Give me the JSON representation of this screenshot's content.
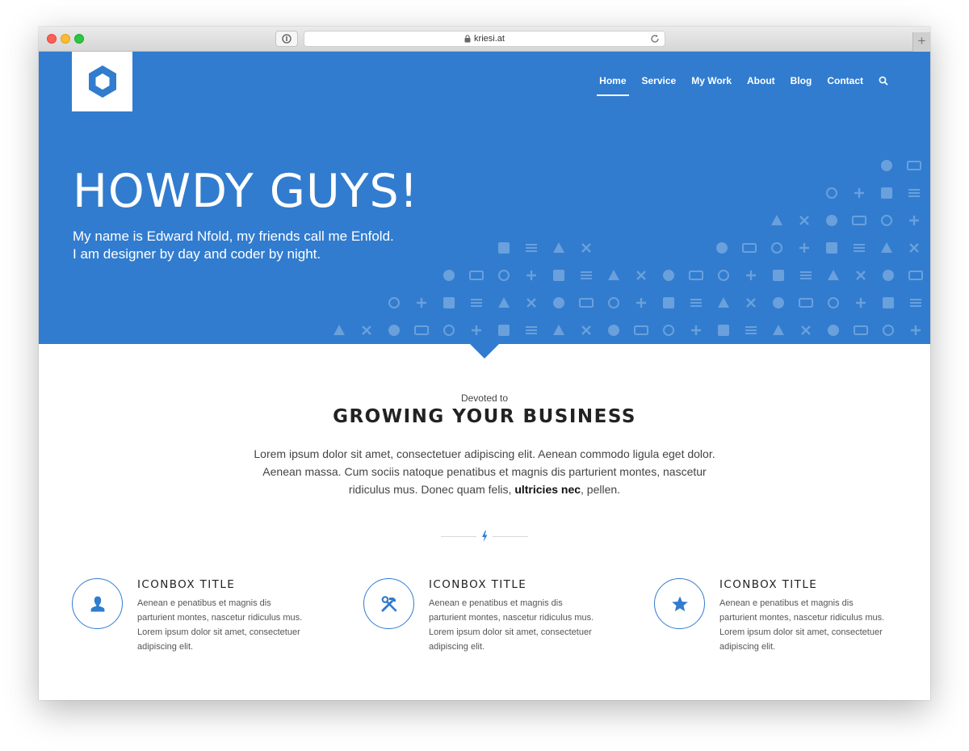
{
  "browser": {
    "url": "kriesi.at",
    "new_tab_label": "+"
  },
  "nav": {
    "items": [
      {
        "label": "Home",
        "active": true
      },
      {
        "label": "Service",
        "active": false
      },
      {
        "label": "My Work",
        "active": false
      },
      {
        "label": "About",
        "active": false
      },
      {
        "label": "Blog",
        "active": false
      },
      {
        "label": "Contact",
        "active": false
      }
    ],
    "search_icon": "search-icon"
  },
  "hero": {
    "title": "HOWDY GUYS!",
    "subtitle_line1": "My name is Edward Nfold, my friends call me Enfold.",
    "subtitle_line2": "I am designer by day and coder by night."
  },
  "section": {
    "kicker": "Devoted to",
    "heading": "GROWING YOUR BUSINESS",
    "intro_main": "Lorem ipsum dolor sit amet, consectetuer adipiscing elit. Aenean commodo ligula eget dolor. Aenean massa. Cum sociis natoque penatibus et magnis dis parturient montes, nascetur ridiculus mus. Donec quam felis, ",
    "intro_bold": "ultricies nec",
    "intro_tail": ", pellen."
  },
  "iconboxes": [
    {
      "icon": "user-icon",
      "title": "ICONBOX TITLE",
      "text": "Aenean e penatibus et magnis dis parturient montes, nascetur ridiculus mus. Lorem ipsum dolor sit amet, consectetuer adipiscing elit."
    },
    {
      "icon": "tools-icon",
      "title": "ICONBOX TITLE",
      "text": "Aenean e penatibus et magnis dis parturient montes, nascetur ridiculus mus. Lorem ipsum dolor sit amet, consectetuer adipiscing elit."
    },
    {
      "icon": "star-icon",
      "title": "ICONBOX TITLE",
      "text": "Aenean e penatibus et magnis dis parturient montes, nascetur ridiculus mus. Lorem ipsum dolor sit amet, consectetuer adipiscing elit."
    }
  ],
  "colors": {
    "brand_blue": "#317ccf",
    "text_dark": "#222222",
    "text_body": "#555555"
  }
}
